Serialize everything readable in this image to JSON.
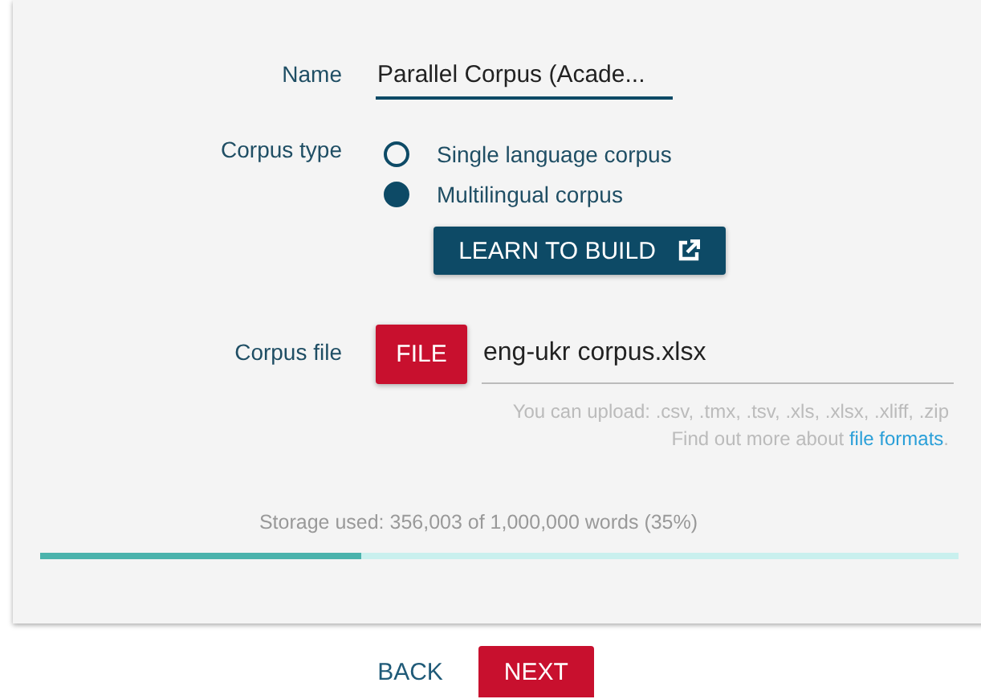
{
  "name_field": {
    "label": "Name",
    "value": "Parallel Corpus (Acade..."
  },
  "corpus_type": {
    "label": "Corpus type",
    "options": [
      {
        "label": "Single language corpus",
        "selected": false
      },
      {
        "label": "Multilingual corpus",
        "selected": true
      }
    ],
    "learn_button": "LEARN TO BUILD"
  },
  "corpus_file": {
    "label": "Corpus file",
    "button": "FILE",
    "value": "eng-ukr corpus.xlsx",
    "hint": "You can upload: .csv, .tmx, .tsv, .xls, .xlsx, .xliff, .zip",
    "more_text": "Find out more about",
    "more_link": "file formats",
    "more_end": "."
  },
  "storage": {
    "text": "Storage used: 356,003 of 1,000,000 words (35%)",
    "level": 0.35
  },
  "buttons": {
    "back": "BACK",
    "next": "NEXT"
  }
}
